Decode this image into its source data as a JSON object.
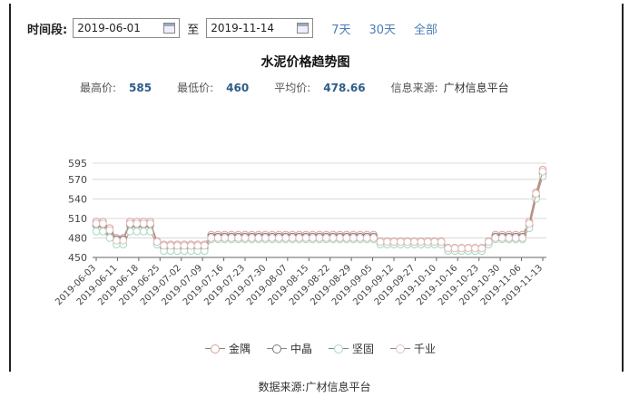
{
  "toolbar": {
    "period_label": "时间段:",
    "start_date": "2019-06-01",
    "to_label": "至",
    "end_date": "2019-11-14",
    "quick": [
      "7天",
      "30天",
      "全部"
    ]
  },
  "chart_title": "水泥价格趋势图",
  "stats": {
    "max_label": "最高价:",
    "max_value": "585",
    "min_label": "最低价:",
    "min_value": "460",
    "avg_label": "平均价:",
    "avg_value": "478.66",
    "source_label": "信息来源:",
    "source_value": "广材信息平台"
  },
  "caption": "数据来源:广材信息平台",
  "colors": {
    "jinyu": "#d8a0a0",
    "zhongjing": "#7a7a7a",
    "jianguo": "#a8d8c0",
    "qianye": "#e0c0c0"
  },
  "chart_data": {
    "type": "line",
    "x_ticks": [
      "2019-06-03",
      "2019-06-11",
      "2019-06-18",
      "2019-06-25",
      "2019-07-02",
      "2019-07-09",
      "2019-07-16",
      "2019-07-23",
      "2019-07-30",
      "2019-08-07",
      "2019-08-15",
      "2019-08-22",
      "2019-08-29",
      "2019-09-05",
      "2019-09-12",
      "2019-09-27",
      "2019-10-10",
      "2019-10-16",
      "2019-10-23",
      "2019-10-30",
      "2019-11-06",
      "2019-11-13"
    ],
    "ylim": [
      450,
      595
    ],
    "y_ticks": [
      450,
      480,
      510,
      540,
      570,
      595
    ],
    "legend_position": "bottom",
    "series": [
      {
        "name": "金隅",
        "color_key": "jinyu",
        "values": [
          505,
          505,
          495,
          480,
          480,
          505,
          505,
          505,
          505,
          475,
          470,
          470,
          470,
          470,
          470,
          470,
          470,
          485,
          485,
          485,
          485,
          485,
          485,
          485,
          485,
          485,
          485,
          485,
          485,
          485,
          485,
          485,
          485,
          485,
          485,
          485,
          485,
          485,
          485,
          485,
          485,
          485,
          475,
          475,
          475,
          475,
          475,
          475,
          475,
          475,
          475,
          475,
          465,
          465,
          465,
          465,
          465,
          465,
          475,
          485,
          485,
          485,
          485,
          485,
          505,
          550,
          585
        ]
      },
      {
        "name": "中晶",
        "color_key": "zhongjing",
        "values": [
          500,
          500,
          490,
          478,
          478,
          500,
          500,
          500,
          500,
          472,
          465,
          465,
          465,
          465,
          465,
          465,
          465,
          482,
          482,
          482,
          482,
          482,
          482,
          482,
          482,
          482,
          482,
          482,
          482,
          482,
          482,
          482,
          482,
          482,
          482,
          482,
          482,
          482,
          482,
          482,
          482,
          482,
          472,
          472,
          472,
          472,
          472,
          472,
          472,
          472,
          472,
          472,
          462,
          462,
          462,
          462,
          462,
          462,
          472,
          482,
          482,
          482,
          482,
          482,
          500,
          545,
          580
        ]
      },
      {
        "name": "坚固",
        "color_key": "jianguo",
        "values": [
          490,
          490,
          480,
          470,
          470,
          490,
          490,
          490,
          490,
          470,
          460,
          460,
          460,
          460,
          460,
          460,
          460,
          478,
          478,
          478,
          478,
          478,
          478,
          478,
          478,
          478,
          478,
          478,
          478,
          478,
          478,
          478,
          478,
          478,
          478,
          478,
          478,
          478,
          478,
          478,
          478,
          478,
          470,
          470,
          470,
          470,
          470,
          470,
          470,
          470,
          470,
          470,
          460,
          460,
          460,
          460,
          460,
          460,
          470,
          478,
          478,
          478,
          478,
          478,
          495,
          540,
          575
        ]
      },
      {
        "name": "千业",
        "color_key": "qianye",
        "values": [
          502,
          502,
          492,
          476,
          476,
          502,
          502,
          502,
          502,
          474,
          468,
          468,
          468,
          468,
          468,
          468,
          468,
          480,
          480,
          480,
          480,
          480,
          480,
          480,
          480,
          480,
          480,
          480,
          480,
          480,
          480,
          480,
          480,
          480,
          480,
          480,
          480,
          480,
          480,
          480,
          480,
          480,
          474,
          474,
          474,
          474,
          474,
          474,
          474,
          474,
          474,
          474,
          464,
          464,
          464,
          464,
          464,
          464,
          474,
          480,
          480,
          480,
          480,
          480,
          502,
          548,
          582
        ]
      }
    ]
  }
}
